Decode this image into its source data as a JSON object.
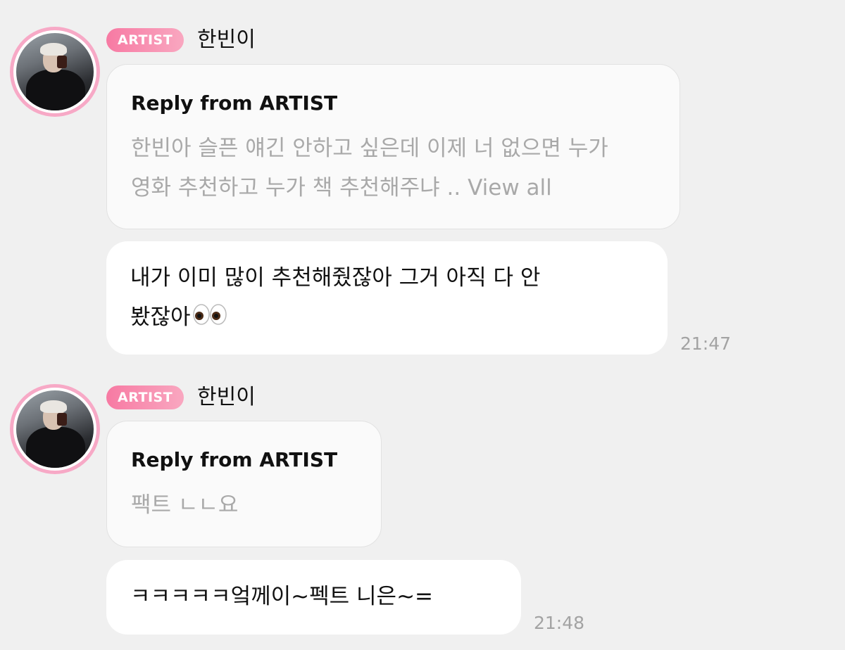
{
  "messages": [
    {
      "badge": "ARTIST",
      "sender": "한빈이",
      "reply": {
        "title": "Reply from ARTIST",
        "line1": "한빈아 슬픈 얘긴 안하고 싶은데 이제 너 없으면 누가",
        "line2": "영화 추천하고 누가 책 추천해주냐 .. View all"
      },
      "text_line1": "내가 이미 많이 추천해줬잖아 그거 아직 다 안",
      "text_line2": "봤잖아",
      "emoji": "eyes-icon",
      "time": "21:47"
    },
    {
      "badge": "ARTIST",
      "sender": "한빈이",
      "reply": {
        "title": "Reply from ARTIST",
        "line1": "팩트 ㄴㄴ요"
      },
      "text_line1": "ㅋㅋㅋㅋㅋ엌께이~펙트 니은~=",
      "time": "21:48"
    }
  ],
  "colors": {
    "background": "#f0f0f0",
    "badge_gradient_start": "#f77aa3",
    "badge_gradient_end": "#f9a7c0",
    "avatar_ring": "#f7a9c6",
    "reply_text": "#a9a9a9",
    "time_text": "#a3a3a3"
  }
}
